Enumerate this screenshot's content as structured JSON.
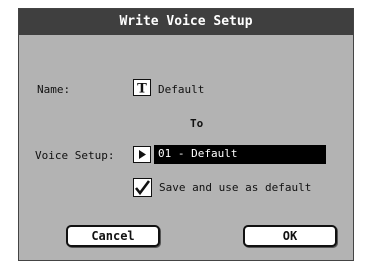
{
  "dialog": {
    "title": "Write Voice Setup",
    "name_label": "Name:",
    "name_icon": "text-edit-icon",
    "name_value": "Default",
    "to_label": "To",
    "voice_setup_label": "Voice Setup:",
    "voice_setup_icon": "play-triangle-icon",
    "voice_setup_value": "01 - Default",
    "checkbox_checked": true,
    "checkbox_label": "Save and use as default",
    "cancel_label": "Cancel",
    "ok_label": "OK"
  },
  "colors": {
    "title_bg": "#3f3f3f",
    "dialog_bg": "#b3b3b3",
    "selected_field_bg": "#000000"
  }
}
